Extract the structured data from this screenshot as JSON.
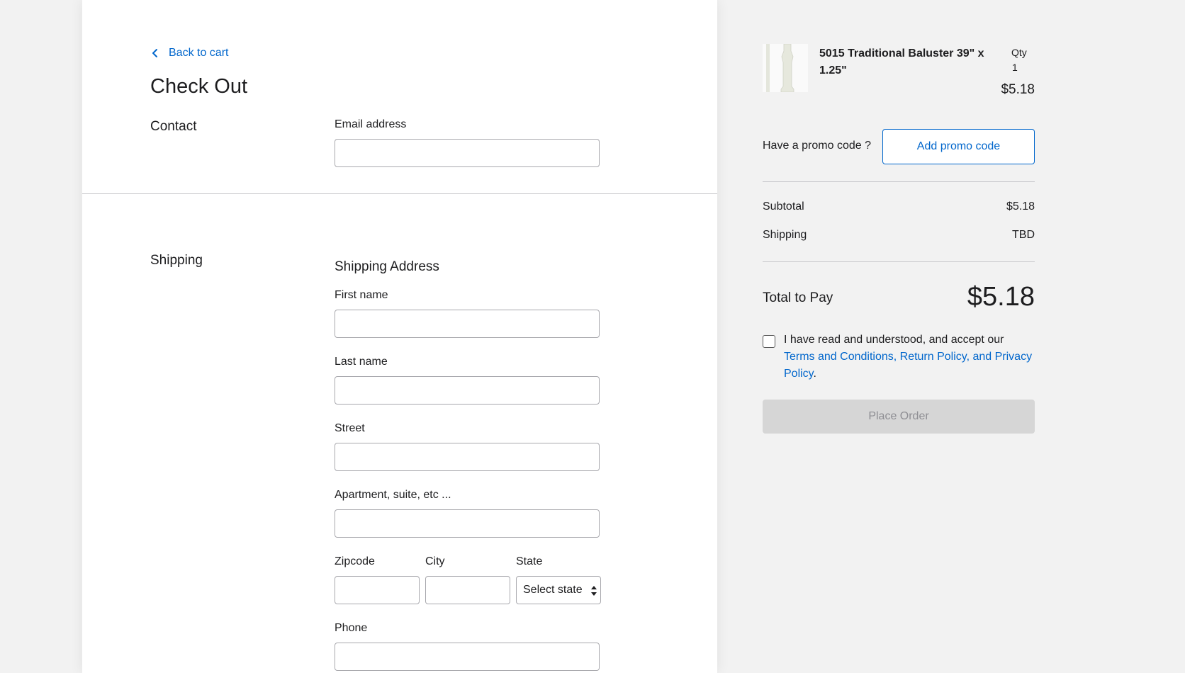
{
  "checkout": {
    "back_link": "Back to cart",
    "title": "Check Out",
    "contact": {
      "section_label": "Contact",
      "email_label": "Email address",
      "email_value": ""
    },
    "shipping": {
      "section_label": "Shipping",
      "heading": "Shipping Address",
      "first_name_label": "First name",
      "last_name_label": "Last name",
      "street_label": "Street",
      "apartment_label": "Apartment, suite, etc ...",
      "zipcode_label": "Zipcode",
      "city_label": "City",
      "state_label": "State",
      "state_selected": "Select state",
      "phone_label": "Phone"
    }
  },
  "summary": {
    "product": {
      "name": "5015 Traditional Baluster 39\" x 1.25\"",
      "qty_label": "Qty",
      "qty_value": "1",
      "price": "$5.18",
      "image_icon": "baluster-image"
    },
    "promo_text": "Have a promo code ?",
    "promo_button": "Add promo code",
    "subtotal_label": "Subtotal",
    "subtotal_value": "$5.18",
    "shipping_label": "Shipping",
    "shipping_value": "TBD",
    "total_label": "Total to Pay",
    "total_value": "$5.18",
    "terms_prefix": "I have read and understood, and accept our",
    "terms_link": "Terms and Conditions, Return Policy, and Privacy Policy",
    "terms_suffix": ".",
    "place_order": "Place Order"
  },
  "colors": {
    "link": "#0066cc",
    "page_background": "#f2f2f2",
    "disabled_button": "#d6d6d6"
  }
}
